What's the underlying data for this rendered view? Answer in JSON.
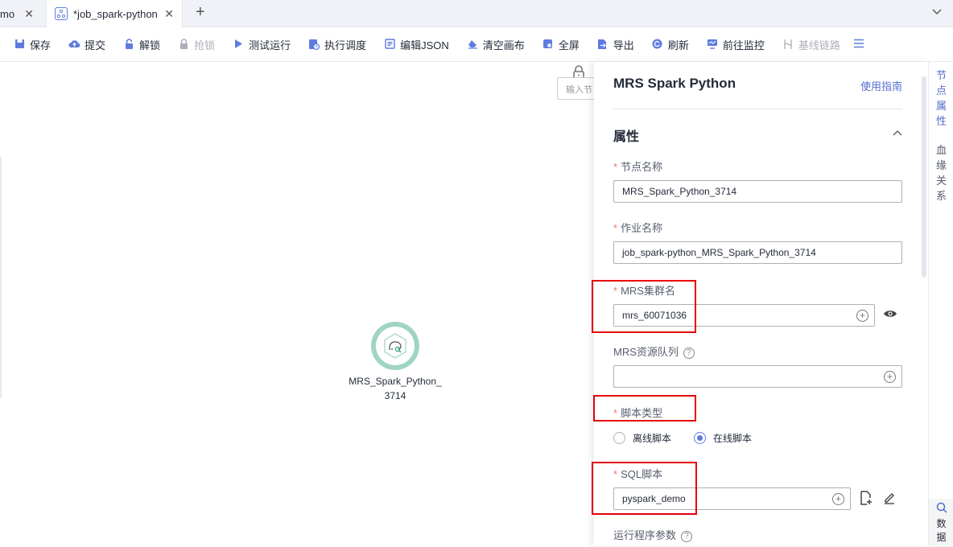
{
  "tabs": [
    {
      "label": "mo",
      "active": false
    },
    {
      "label": "*job_spark-python",
      "active": true
    }
  ],
  "toolbar": {
    "items": [
      {
        "label": "保存",
        "icon": "save-icon",
        "disabled": false
      },
      {
        "label": "提交",
        "icon": "upload-cloud-icon",
        "disabled": false
      },
      {
        "label": "解锁",
        "icon": "unlock-icon",
        "disabled": false
      },
      {
        "label": "抢锁",
        "icon": "lock-icon",
        "disabled": true
      },
      {
        "label": "测试运行",
        "icon": "play-icon",
        "disabled": false
      },
      {
        "label": "执行调度",
        "icon": "schedule-icon",
        "disabled": false
      },
      {
        "label": "编辑JSON",
        "icon": "json-edit-icon",
        "disabled": false
      },
      {
        "label": "清空画布",
        "icon": "eraser-icon",
        "disabled": false
      },
      {
        "label": "全屏",
        "icon": "fullscreen-icon",
        "disabled": false
      },
      {
        "label": "导出",
        "icon": "export-icon",
        "disabled": false
      },
      {
        "label": "刷新",
        "icon": "refresh-icon",
        "disabled": false
      },
      {
        "label": "前往监控",
        "icon": "monitor-icon",
        "disabled": false
      },
      {
        "label": "基线链路",
        "icon": "baseline-icon",
        "disabled": true
      }
    ]
  },
  "canvas": {
    "search_placeholder": "输入节",
    "node": {
      "label": "MRS_Spark_Python_3714",
      "label_line1": "MRS_Spark_Python_",
      "label_line2": "3714",
      "icon": "spark-node-icon"
    }
  },
  "panel": {
    "title": "MRS Spark Python",
    "guide_link": "使用指南",
    "section": "属性",
    "node_name": {
      "label": "节点名称",
      "value": "MRS_Spark_Python_3714"
    },
    "job_name": {
      "label": "作业名称",
      "value": "job_spark-python_MRS_Spark_Python_3714"
    },
    "cluster": {
      "label": "MRS集群名",
      "value": "mrs_60071036"
    },
    "queue": {
      "label": "MRS资源队列",
      "value": ""
    },
    "script_type": {
      "label": "脚本类型",
      "options": [
        "离线脚本",
        "在线脚本"
      ],
      "selected": "在线脚本"
    },
    "sql_script": {
      "label": "SQL脚本",
      "value": "pyspark_demo"
    },
    "run_params": {
      "label": "运行程序参数"
    }
  },
  "right_strip": {
    "tab1": [
      "节",
      "点",
      "属",
      "性"
    ],
    "tab2": [
      "血",
      "缘",
      "关",
      "系"
    ],
    "search_label": [
      "数",
      "据"
    ]
  },
  "colors": {
    "accent": "#5e7ce0",
    "highlight": "#e6000c",
    "node_ring": "#9fd5c2"
  }
}
